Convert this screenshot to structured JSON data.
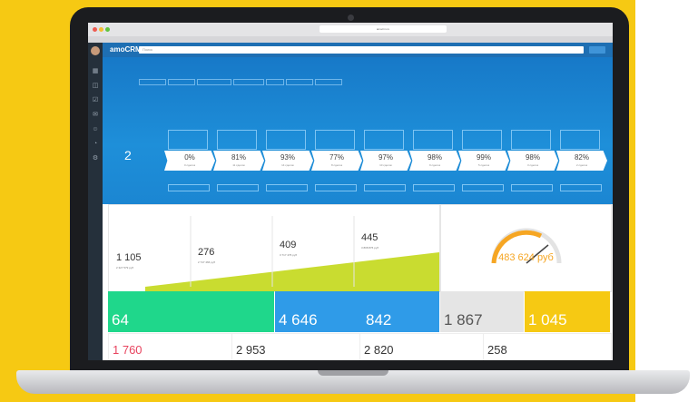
{
  "browser": {
    "url": "amocrm.ru"
  },
  "app": {
    "logo": "amoCRM.",
    "search_placeholder": "Поиск"
  },
  "funnel": {
    "stage_count": "2",
    "stages": [
      {
        "pct": "0%",
        "sub": "0 сделок"
      },
      {
        "pct": "81%",
        "sub": "11 сделок"
      },
      {
        "pct": "93%",
        "sub": "14 сделок"
      },
      {
        "pct": "77%",
        "sub": "8 сделок"
      },
      {
        "pct": "97%",
        "sub": "10 сделок"
      },
      {
        "pct": "98%",
        "sub": "9 сделок"
      },
      {
        "pct": "99%",
        "sub": "5 сделок"
      },
      {
        "pct": "98%",
        "sub": "3 сделок"
      },
      {
        "pct": "82%",
        "sub": "2 сделок"
      }
    ]
  },
  "sales_widget": {
    "steps": [
      {
        "value": "1 105",
        "sub": "2 327 579 руб"
      },
      {
        "value": "276",
        "sub": "2 747 466 руб"
      },
      {
        "value": "409",
        "sub": "3 717 476 руб"
      },
      {
        "value": "445",
        "sub": "3 808 876 руб"
      }
    ]
  },
  "gauge_widget": {
    "value": "483 624 руб"
  },
  "tiles_row1": [
    {
      "value": "64",
      "color": "#1fd78b"
    },
    {
      "value": "4 646",
      "color": "#2f9be8"
    },
    {
      "value": "842",
      "color": "#2f9be8"
    },
    {
      "value": "1 867",
      "color": "#e5e5e5"
    },
    {
      "value": "1 045",
      "color": "#f6c913"
    }
  ],
  "tiles_row2": [
    {
      "value": "1 760",
      "color": "#e8445f"
    },
    {
      "value": "2 953",
      "color": "#333333"
    },
    {
      "value": "2 820",
      "color": "#333333"
    },
    {
      "value": "258",
      "color": "#333333"
    }
  ],
  "colors": {
    "brand_yellow": "#f6c913",
    "app_blue": "#1e8fd9",
    "green": "#1fd78b",
    "gauge_orange": "#f6a623"
  }
}
